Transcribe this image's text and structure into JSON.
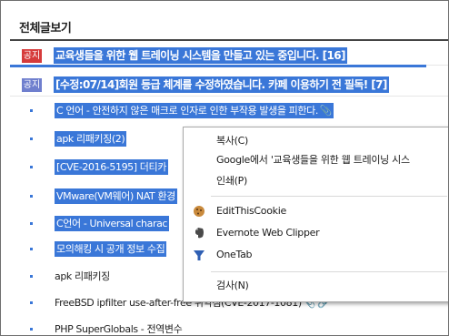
{
  "board": {
    "title": "전체글보기"
  },
  "notices": [
    {
      "badge": "공지",
      "text": "교육생들을 위한 웹 트레이닝 시스템을 만들고 있는 중입니다.",
      "count": "[16]"
    },
    {
      "badge": "공지",
      "text": "[수정:07/14]회원 등급 체계를 수정하였습니다. 카페 이용하기 전 필독!",
      "count": "[7]"
    }
  ],
  "posts": [
    {
      "title": "C 언어 - 안전하지 않은 매크로 인자로 인한 부작용 발생을 피한다.",
      "selected": true
    },
    {
      "title": "apk 리패키징(2)",
      "selected": true
    },
    {
      "title": "[CVE-2016-5195] 더티카",
      "selected": true
    },
    {
      "title": "VMware(VM웨어) NAT 환경",
      "selected": true
    },
    {
      "title": "C언어 - Universal charac",
      "selected": true
    },
    {
      "title": "모의해킹 시 공개 정보 수집",
      "selected": true
    },
    {
      "title": "apk 리패키징",
      "selected": false
    },
    {
      "title": "FreeBSD ipfilter use-after-free 취약점(CVE-2017-1081)",
      "selected": false
    },
    {
      "title": "PHP SuperGlobals - 전역변수",
      "selected": false
    }
  ],
  "context_menu": {
    "copy": "복사(C)",
    "google_search": "Google에서 '교육생들을 위한 웹 트레이닝 시스",
    "print": "인쇄(P)",
    "edit_this_cookie": "EditThisCookie",
    "evernote": "Evernote Web Clipper",
    "onetab": "OneTab",
    "inspect": "검사(N)"
  },
  "colors": {
    "selection": "#3a77d8",
    "notice_red": "#d63b3b",
    "notice_blue": "#6f7fce"
  }
}
